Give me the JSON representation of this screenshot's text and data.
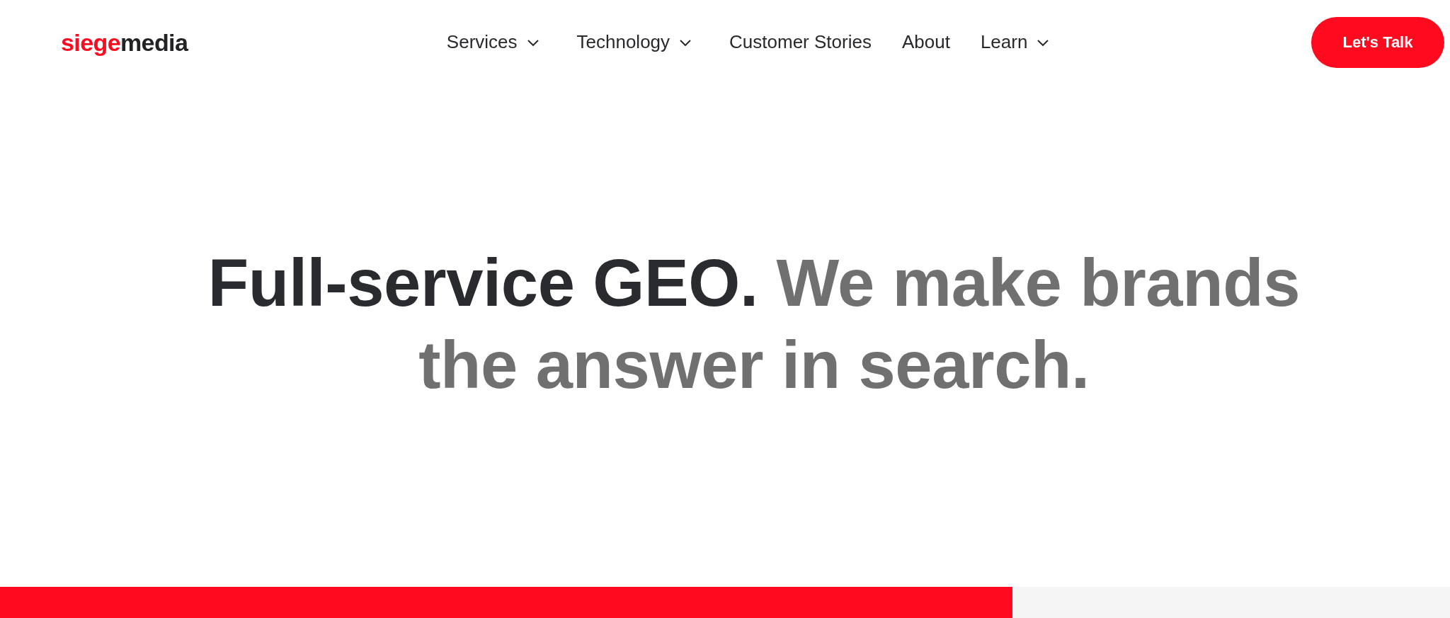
{
  "logo": {
    "accent": "siege",
    "rest": "media"
  },
  "nav": [
    {
      "label": "Services",
      "kind": "menu"
    },
    {
      "label": "Technology",
      "kind": "menu"
    },
    {
      "label": "Customer Stories",
      "kind": "link"
    },
    {
      "label": "About",
      "kind": "link"
    },
    {
      "label": "Learn",
      "kind": "menu"
    }
  ],
  "cta": {
    "label": "Let's Talk"
  },
  "headline": {
    "lead": "Full-service GEO.",
    "rest": "We make brands the answer in search."
  }
}
